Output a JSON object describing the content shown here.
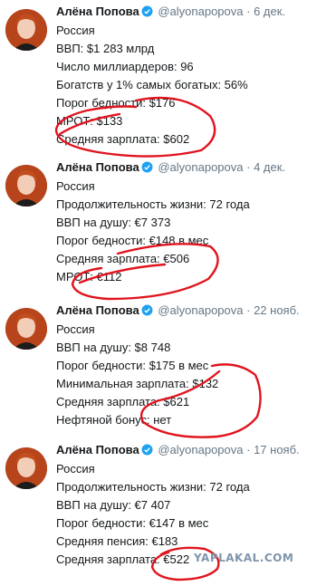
{
  "tweets": [
    {
      "name": "Алёна Попова",
      "handle": "@alyonapopova",
      "dot": "·",
      "date": "6 дек.",
      "lines": [
        "Россия",
        "ВВП: $1 283 млрд",
        "Число миллиардеров: 96",
        "Богатств у 1% самых богатых: 56%",
        "Порог бедности: $176",
        "МРОТ: $133",
        "Средняя зарплата: $602"
      ]
    },
    {
      "name": "Алёна Попова",
      "handle": "@alyonapopova",
      "dot": "·",
      "date": "4 дек.",
      "lines": [
        "Россия",
        "Продолжительность жизни: 72 года",
        "ВВП на душу: €7 373",
        "Порог бедности: €148 в мес",
        "Средняя зарплата: €506",
        "МРОТ: €112"
      ]
    },
    {
      "name": "Алёна Попова",
      "handle": "@alyonapopova",
      "dot": "·",
      "date": "22 нояб.",
      "lines": [
        "Россия",
        "ВВП на душу: $8 748",
        "Порог бедности: $175 в мес",
        "Минимальная зарплата: $132",
        "Средняя зарплата: $621",
        "Нефтяной бонус: нет"
      ]
    },
    {
      "name": "Алёна Попова",
      "handle": "@alyonapopova",
      "dot": "·",
      "date": "17 нояб.",
      "lines": [
        "Россия",
        "Продолжительность жизни: 72 года",
        "ВВП на душу: €7 407",
        "Порог бедности: €147 в мес",
        "Средняя пенсия: €183",
        "Средняя зарплата: €522"
      ]
    }
  ],
  "watermark": "YAPLAKAL.COM",
  "colors": {
    "verified": "#1da1f2",
    "scribble": "#e0141e",
    "muted": "#657786"
  }
}
